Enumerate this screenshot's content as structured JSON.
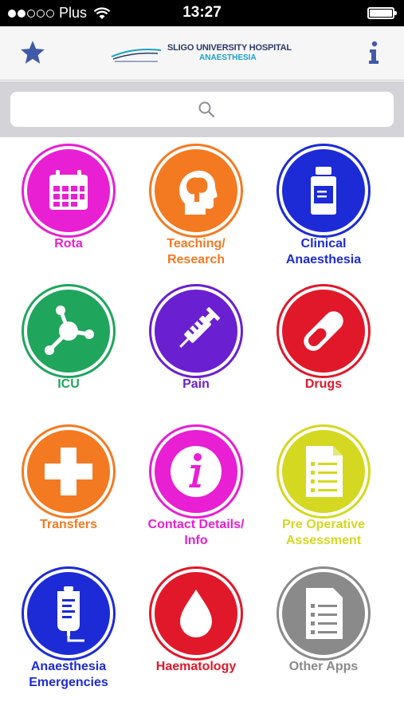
{
  "status_bar": {
    "carrier": "Plus",
    "time": "13:27"
  },
  "header": {
    "title": "SLIGO UNIVERSITY HOSPITAL",
    "subtitle": "ANAESTHESIA",
    "left_icon": "star-icon",
    "right_icon": "info-icon"
  },
  "search": {
    "placeholder": ""
  },
  "tiles": [
    {
      "label": "Rota",
      "color": "#e81fd2",
      "icon": "calendar-icon"
    },
    {
      "label": "Teaching/\nResearch",
      "color": "#f47a22",
      "icon": "head-brain-icon"
    },
    {
      "label": "Clinical\nAnaesthesia",
      "color": "#1c2bd6",
      "icon": "medicine-bottle-icon"
    },
    {
      "label": "ICU",
      "color": "#1fa55c",
      "icon": "molecule-icon"
    },
    {
      "label": "Pain",
      "color": "#6a1fd1",
      "icon": "syringe-icon"
    },
    {
      "label": "Drugs",
      "color": "#e0182a",
      "icon": "pill-icon"
    },
    {
      "label": "Transfers",
      "color": "#f47a22",
      "icon": "cross-icon"
    },
    {
      "label": "Contact Details/\nInfo",
      "color": "#e81fd2",
      "icon": "info-circle-icon"
    },
    {
      "label": "Pre Operative\nAssessment",
      "color": "#d4d820",
      "icon": "checklist-icon"
    },
    {
      "label": "Anaesthesia\nEmergencies",
      "color": "#1c2bd6",
      "icon": "iv-bag-icon"
    },
    {
      "label": "Haematology",
      "color": "#e0182a",
      "icon": "blood-drop-icon"
    },
    {
      "label": "Other Apps",
      "color": "#8a8a8a",
      "icon": "document-icon"
    }
  ]
}
